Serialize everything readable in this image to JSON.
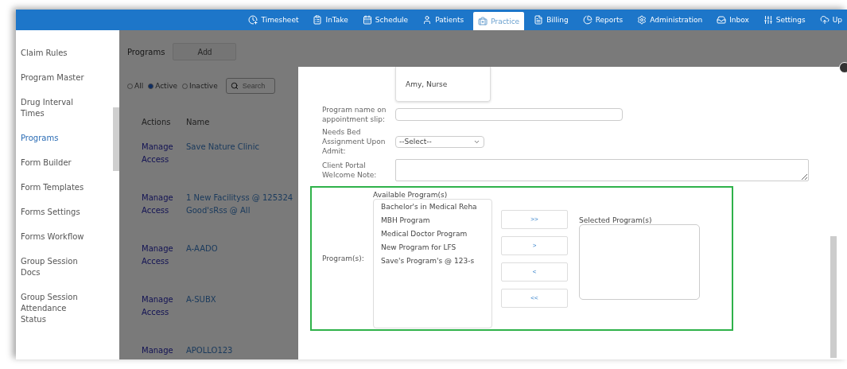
{
  "nav": {
    "items": [
      {
        "kind": "timesheet",
        "label": "Timesheet",
        "selected": false
      },
      {
        "kind": "intake",
        "label": "InTake",
        "selected": false
      },
      {
        "kind": "schedule",
        "label": "Schedule",
        "selected": false
      },
      {
        "kind": "patients",
        "label": "Patients",
        "selected": false
      },
      {
        "kind": "practice",
        "label": "Practice",
        "selected": true
      },
      {
        "kind": "billing",
        "label": "Billing",
        "selected": false
      },
      {
        "kind": "reports",
        "label": "Reports",
        "selected": false
      },
      {
        "kind": "administration",
        "label": "Administration",
        "selected": false
      },
      {
        "kind": "inbox",
        "label": "Inbox",
        "selected": false
      },
      {
        "kind": "settings",
        "label": "Settings",
        "selected": false
      },
      {
        "kind": "upload",
        "label": "Up",
        "selected": false
      }
    ]
  },
  "sidebar": {
    "items": [
      {
        "label": "Claim Rules",
        "selected": false
      },
      {
        "label": "Program Master",
        "selected": false
      },
      {
        "label": "Drug Interval Times",
        "selected": false
      },
      {
        "label": "Programs",
        "selected": true
      },
      {
        "label": "Form Builder",
        "selected": false
      },
      {
        "label": "Form Templates",
        "selected": false
      },
      {
        "label": "Forms Settings",
        "selected": false
      },
      {
        "label": "Forms Workflow",
        "selected": false
      },
      {
        "label": "Group Session Docs",
        "selected": false
      },
      {
        "label": "Group Session Attendance Status",
        "selected": false
      }
    ]
  },
  "programs_page": {
    "title": "Programs",
    "add_button": "Add",
    "filters": [
      {
        "label": "All",
        "selected": false
      },
      {
        "label": "Active",
        "selected": true
      },
      {
        "label": "Inactive",
        "selected": false
      }
    ],
    "search": {
      "placeholder": "Search"
    },
    "table": {
      "columns": [
        "Actions",
        "Name"
      ],
      "rows": [
        {
          "action": "Manage Access",
          "name": "Save Nature Clinic"
        },
        {
          "action": "Manage Access",
          "name": "1 New Facilityss @ 125324 Good'sRss @ All"
        },
        {
          "action": "Manage Access",
          "name": "A-AADO"
        },
        {
          "action": "Manage Access",
          "name": "A-SUBX"
        },
        {
          "action": "Manage",
          "name": "APOLLO123"
        }
      ]
    }
  },
  "modal": {
    "staff_entry": "Amy, Nurse",
    "fields": [
      {
        "kind": "input",
        "label": "Program name on appointment slip:"
      },
      {
        "kind": "select",
        "label": "Needs Bed Assignment Upon Admit:",
        "value": "--Select--"
      },
      {
        "kind": "textarea",
        "label": "Client Portal Welcome Note:"
      }
    ],
    "programs": {
      "label": "Program(s):",
      "available_label": "Available Program(s)",
      "available": [
        "Bachelor's in Medical Reha",
        "MBH Program",
        "Medical Doctor Program",
        "New Program for LFS",
        "Save's Program's @ 123-s"
      ],
      "buttons": [
        ">>",
        ">",
        "<",
        "<<"
      ],
      "selected_label": "Selected Program(s)"
    }
  }
}
